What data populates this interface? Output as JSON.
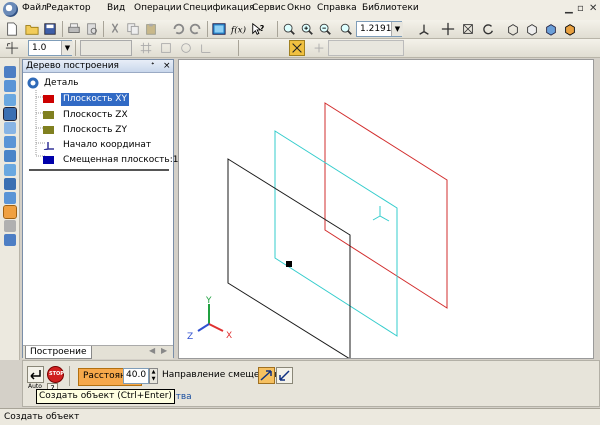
{
  "menubar": {
    "items": [
      "Файл",
      "Редактор",
      "Вид",
      "Операции",
      "Спецификация",
      "Сервис",
      "Окно",
      "Справка",
      "Библиотеки"
    ],
    "app_icon": "kompas-logo-icon",
    "window_controls": [
      "minimize-icon",
      "restore-icon",
      "close-icon"
    ]
  },
  "toolbar_main": {
    "icons": [
      "new-document-icon",
      "open-folder-icon",
      "save-icon",
      "print-icon",
      "print-preview-icon",
      "cut-icon",
      "copy-icon",
      "paste-icon",
      "undo-icon",
      "redo-icon",
      "variables-icon",
      "function-icon",
      "help-cursor-icon",
      "zoom-region-icon",
      "zoom-in-icon",
      "zoom-out-icon",
      "zoom-fit-icon"
    ],
    "zoom_value": "1.2191",
    "right_icons": [
      "orientation-icon",
      "move-icon",
      "rotate-icon",
      "wireframe-icon",
      "hidden-lines-icon",
      "shaded-icon",
      "shaded-edges-icon"
    ]
  },
  "toolbar_secondary": {
    "step_value": "1.0",
    "icons": [
      "cursor-step-icon",
      "layer-icon",
      "grid-icon",
      "snap-icon",
      "scale-icon",
      "local-cs-icon",
      "coordinate-icon"
    ]
  },
  "left_strip_icons": [
    "edit-details-icon",
    "curves-icon",
    "surfaces-icon",
    "arrays-icon",
    "aux-geometry-icon",
    "measure-icon",
    "filter-icon",
    "specification-icon",
    "reports-icon",
    "sketch-line-icon",
    "sketch-icon",
    "solid-icon",
    "assembly-icon"
  ],
  "tree": {
    "title": "Дерево построения",
    "pin_glyph": "ᐩ",
    "close_glyph": "×",
    "root": "Деталь",
    "items": [
      {
        "label": "Плоскость XY",
        "icon": "plane-xy-icon",
        "color": "#cc0000",
        "selected": true
      },
      {
        "label": "Плоскость ZX",
        "icon": "plane-zx-icon",
        "color": "#808020",
        "selected": false
      },
      {
        "label": "Плоскость ZY",
        "icon": "plane-zy-icon",
        "color": "#808020",
        "selected": false
      },
      {
        "label": "Начало координат",
        "icon": "origin-icon",
        "color": "#333399",
        "selected": false
      },
      {
        "label": "Смещенная плоскость:1",
        "icon": "offset-plane-icon",
        "color": "#0000aa",
        "selected": false
      }
    ],
    "tab": "Построение"
  },
  "viewport": {
    "axis_labels": {
      "x": "X",
      "y": "Y",
      "z": "Z"
    },
    "colors": {
      "plane_xy": "#d22c2c",
      "plane_offset": "#33cccc",
      "plane_black": "#1a1a1a",
      "axis_x": "#e03030",
      "axis_y": "#20a040",
      "axis_z": "#3050d0"
    }
  },
  "properties": {
    "distance_label": "Расстояние",
    "distance_value": "40.0",
    "direction_label": "Направление смещения",
    "auto_label": "Auto",
    "tab_label": "войства",
    "stop_label": "STOP"
  },
  "tooltip": "Создать объект (Ctrl+Enter)",
  "status": "Создать объект"
}
